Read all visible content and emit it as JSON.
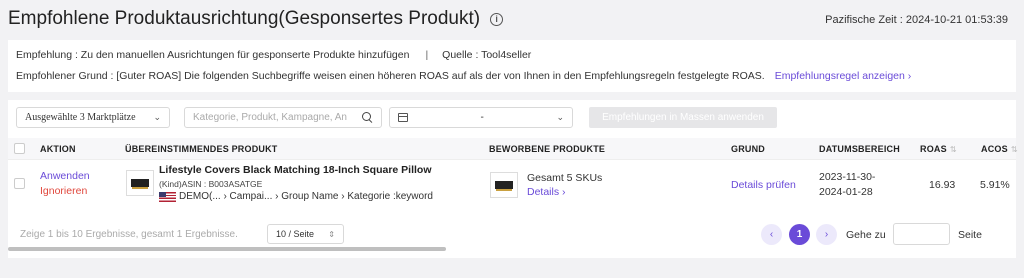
{
  "header": {
    "title": "Empfohlene Produktausrichtung(Gesponsertes Produkt)",
    "time_label": "Pazifische Zeit : 2024-10-21 01:53:39"
  },
  "recommendation": {
    "line1_left": "Empfehlung : Zu den manuellen Ausrichtungen für gesponserte Produkte hinzufügen",
    "separator": "|",
    "line1_right": "Quelle : Tool4seller",
    "line2": "Empfohlener Grund : [Guter ROAS] Die folgenden Suchbegriffe weisen einen höheren ROAS auf als der von Ihnen in den Empfehlungsregeln festgelegte ROAS.",
    "rule_link": "Empfehlungsregel anzeigen ›"
  },
  "toolbar": {
    "marketplace": "Ausgewählte 3 Marktplätze",
    "search_placeholder": "Kategorie, Produkt, Kampagne, An",
    "date_separator": "-",
    "bulk_button": "Empfehlungen in Massen anwenden"
  },
  "table": {
    "headers": {
      "action": "AKTION",
      "matching": "ÜBEREINSTIMMENDES PRODUKT",
      "advertised": "BEWORBENE PRODUKTE",
      "reason": "GRUND",
      "date_range": "DATUMSBEREICH",
      "roas": "ROAS",
      "acos": "ACOS"
    },
    "rows": [
      {
        "apply": "Anwenden",
        "ignore": "Ignorieren",
        "product_title": "Lifestyle Covers Black Matching 18-Inch Square Pillow",
        "asin": "(Kind)ASIN : B003ASATGE",
        "path": "DEMO(...   › Campai...  › Group Name › Kategorie :keyword",
        "advertised_total": "Gesamt 5 SKUs",
        "details": "Details ›",
        "reason": "Details prüfen",
        "date_from": "2023-11-30-",
        "date_to": "2024-01-28",
        "roas": "16.93",
        "acos": "5.91%"
      }
    ]
  },
  "footer": {
    "summary": "Zeige 1 bis 10 Ergebnisse, gesamt 1 Ergebnisse.",
    "page_size": "10 / Seite",
    "current_page": "1",
    "goto_label": "Gehe zu",
    "page_suffix": "Seite"
  },
  "colors": {
    "accent": "#6a4bd8",
    "danger": "#e0473c"
  }
}
